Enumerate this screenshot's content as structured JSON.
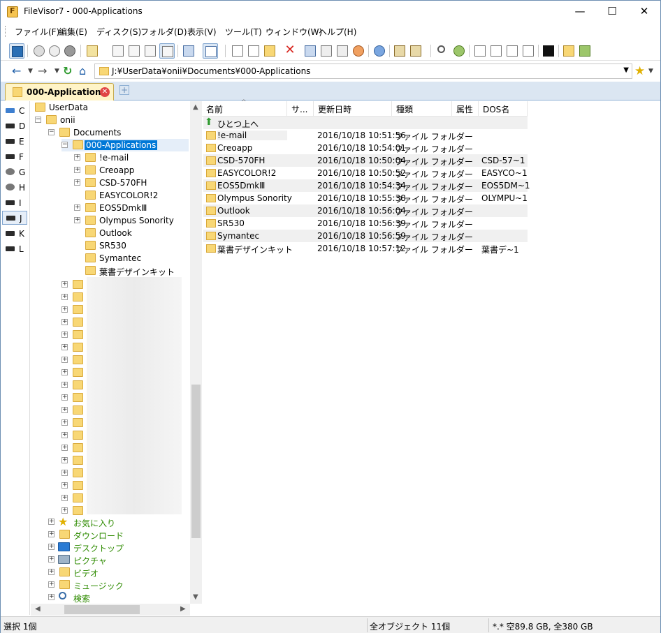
{
  "window": {
    "title": "FileVisor7 - 000-Applications",
    "min": "—",
    "max": "☐",
    "close": "✕"
  },
  "menu": [
    "ファイル(F)",
    "編集(E)",
    "ディスク(S)",
    "フォルダ(D)",
    "表示(V)",
    "ツール(T)",
    "ウィンドウ(W)",
    "ヘルプ(H)"
  ],
  "address": {
    "path": "J:¥UserData¥onii¥Documents¥000-Applications"
  },
  "tab": {
    "label": "000-Applications"
  },
  "drives": [
    "C",
    "D",
    "E",
    "F",
    "G",
    "H",
    "I",
    "J",
    "K",
    "L"
  ],
  "tree": {
    "root": "UserData",
    "user": "onii",
    "documents": "Documents",
    "selected": "000-Applications",
    "children": [
      "!e-mail",
      "Creoapp",
      "CSD-570FH",
      "EASYCOLOR!2",
      "EOS5DmkⅢ",
      "Olympus Sonority",
      "Outlook",
      "SR530",
      "Symantec",
      "葉書デザインキット"
    ],
    "specials": [
      "お気に入り",
      "ダウンロード",
      "デスクトップ",
      "ピクチャ",
      "ビデオ",
      "ミュージック",
      "検索"
    ]
  },
  "list": {
    "columns": [
      "名前",
      "サ...",
      "更新日時",
      "種類",
      "属性",
      "DOS名"
    ],
    "up_label": "ひとつ上へ",
    "rows": [
      {
        "name": "!e-mail",
        "date": "2016/10/18 10:51:56",
        "type": "ファイル フォルダー",
        "dos": ""
      },
      {
        "name": "Creoapp",
        "date": "2016/10/18 10:54:01",
        "type": "ファイル フォルダー",
        "dos": ""
      },
      {
        "name": "CSD-570FH",
        "date": "2016/10/18 10:50:04",
        "type": "ファイル フォルダー",
        "dos": "CSD-57~1"
      },
      {
        "name": "EASYCOLOR!2",
        "date": "2016/10/18 10:50:52",
        "type": "ファイル フォルダー",
        "dos": "EASYCO~1"
      },
      {
        "name": "EOS5DmkⅢ",
        "date": "2016/10/18 10:54:34",
        "type": "ファイル フォルダー",
        "dos": "EOS5DM~1"
      },
      {
        "name": "Olympus Sonority",
        "date": "2016/10/18 10:55:38",
        "type": "ファイル フォルダー",
        "dos": "OLYMPU~1"
      },
      {
        "name": "Outlook",
        "date": "2016/10/18 10:56:04",
        "type": "ファイル フォルダー",
        "dos": ""
      },
      {
        "name": "SR530",
        "date": "2016/10/18 10:56:39",
        "type": "ファイル フォルダー",
        "dos": ""
      },
      {
        "name": "Symantec",
        "date": "2016/10/18 10:56:59",
        "type": "ファイル フォルダー",
        "dos": ""
      },
      {
        "name": "葉書デザインキット",
        "date": "2016/10/18 10:57:12",
        "type": "ファイル フォルダー",
        "dos": "葉書デ~1"
      }
    ]
  },
  "status": {
    "selection": "選択 1個",
    "objects": "全オブジェクト 11個",
    "disk": "*.* 空89.8 GB, 全380 GB"
  },
  "colors": {
    "selection": "#0078d7",
    "folder": "#f8d775",
    "special_text": "#2e8b00"
  }
}
